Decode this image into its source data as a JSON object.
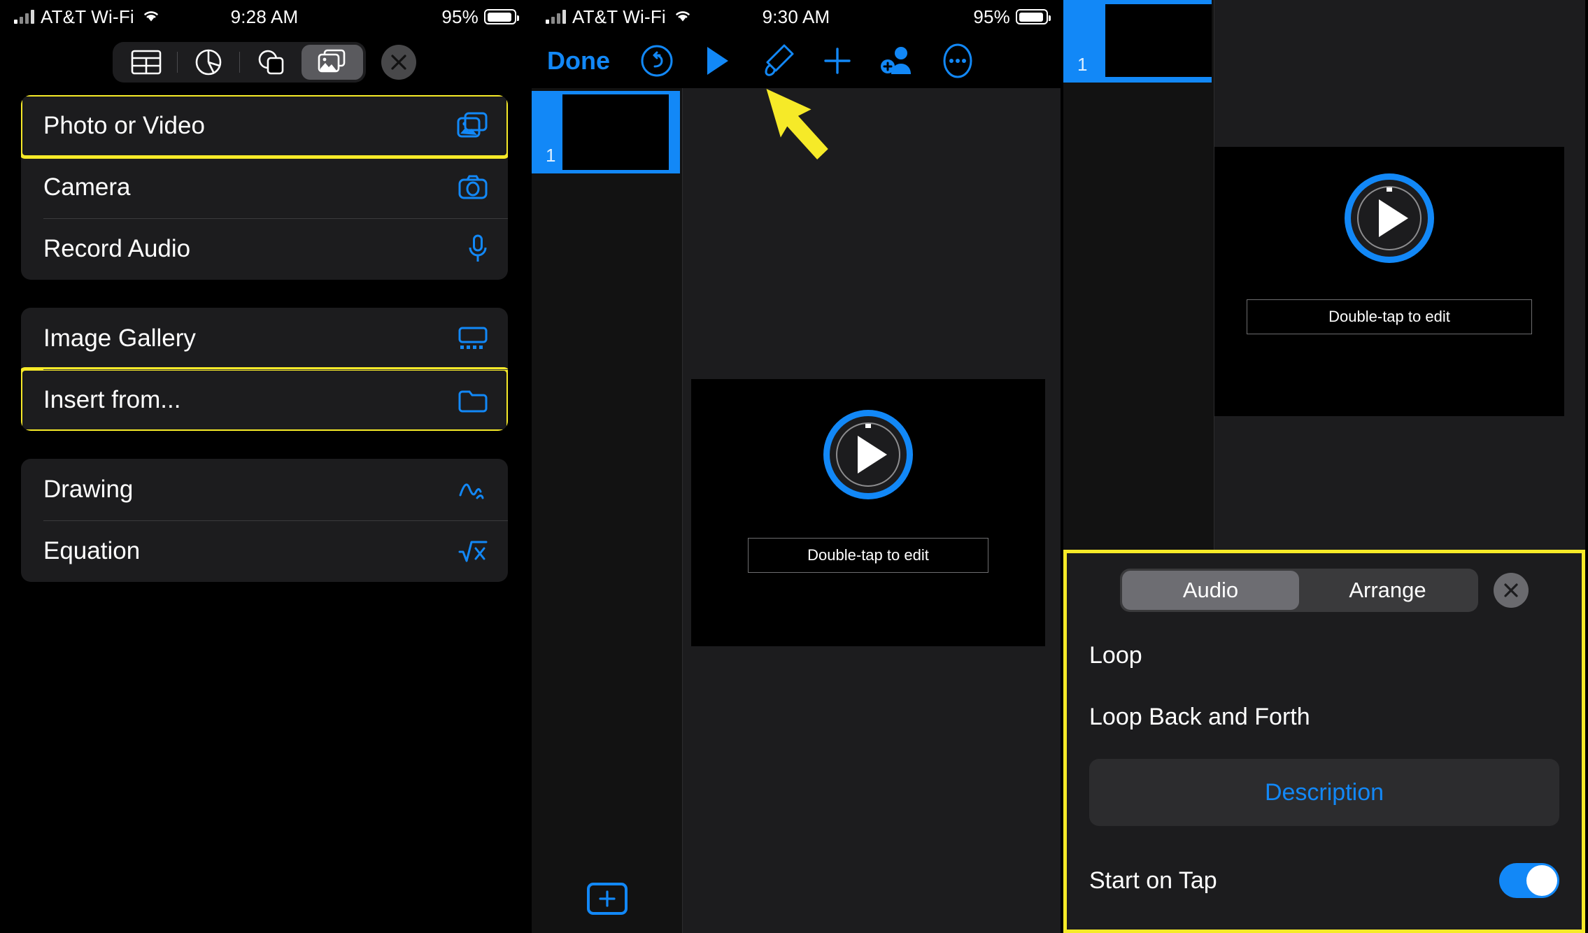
{
  "panels": [
    {
      "status_bar": {
        "carrier": "AT&T Wi-Fi",
        "time": "9:28 AM",
        "battery_percent": "95%"
      },
      "insert_toolbar": {
        "items": [
          {
            "name": "table",
            "label": "Table",
            "active": false
          },
          {
            "name": "chart",
            "label": "Chart",
            "active": false
          },
          {
            "name": "shape",
            "label": "Shape",
            "active": false
          },
          {
            "name": "media",
            "label": "Media",
            "active": true
          }
        ],
        "close_label": "Close"
      },
      "menu_groups": [
        {
          "items": [
            {
              "label": "Photo or Video",
              "icon": "photo-video-icon",
              "highlighted": true
            },
            {
              "label": "Camera",
              "icon": "camera-icon",
              "highlighted": false
            },
            {
              "label": "Record Audio",
              "icon": "microphone-icon",
              "highlighted": false
            }
          ]
        },
        {
          "items": [
            {
              "label": "Image Gallery",
              "icon": "image-gallery-icon",
              "highlighted": false
            },
            {
              "label": "Insert from...",
              "icon": "folder-icon",
              "highlighted": true
            }
          ]
        },
        {
          "items": [
            {
              "label": "Drawing",
              "icon": "drawing-icon",
              "highlighted": false
            },
            {
              "label": "Equation",
              "icon": "equation-icon",
              "highlighted": false
            }
          ]
        }
      ]
    },
    {
      "status_bar": {
        "carrier": "AT&T Wi-Fi",
        "time": "9:30 AM",
        "battery_percent": "95%"
      },
      "toolbar": {
        "done_label": "Done",
        "icons": [
          {
            "name": "undo-icon",
            "label": "Undo"
          },
          {
            "name": "play-icon",
            "label": "Play"
          },
          {
            "name": "format-brush-icon",
            "label": "Format"
          },
          {
            "name": "plus-icon",
            "label": "Insert"
          },
          {
            "name": "add-collaborator-icon",
            "label": "Collaborate"
          },
          {
            "name": "more-icon",
            "label": "More"
          }
        ]
      },
      "slide_rail": {
        "slide_number": "1",
        "add_slide_label": "Add Slide"
      },
      "video_placeholder": {
        "caption": "Double-tap to edit"
      },
      "annotation": {
        "type": "arrow",
        "color": "#f6ea28",
        "points_to": "format-brush-icon"
      }
    },
    {
      "slide_rail": {
        "slide_number": "1"
      },
      "video_placeholder": {
        "caption": "Double-tap to edit"
      },
      "sheet": {
        "tabs": [
          {
            "label": "Audio",
            "active": true
          },
          {
            "label": "Arrange",
            "active": false
          }
        ],
        "close_label": "Close",
        "rows": [
          {
            "label": "Loop",
            "control": "none"
          },
          {
            "label": "Loop Back and Forth",
            "control": "none"
          }
        ],
        "description_button": "Description",
        "start_on_tap": {
          "label": "Start on Tap",
          "value": "on"
        }
      }
    }
  ],
  "colors": {
    "accent_blue": "#1288f7",
    "highlight_yellow": "#f6ea28",
    "panel_bg": "#1c1c1e",
    "group_bg": "#1c1c1e"
  }
}
